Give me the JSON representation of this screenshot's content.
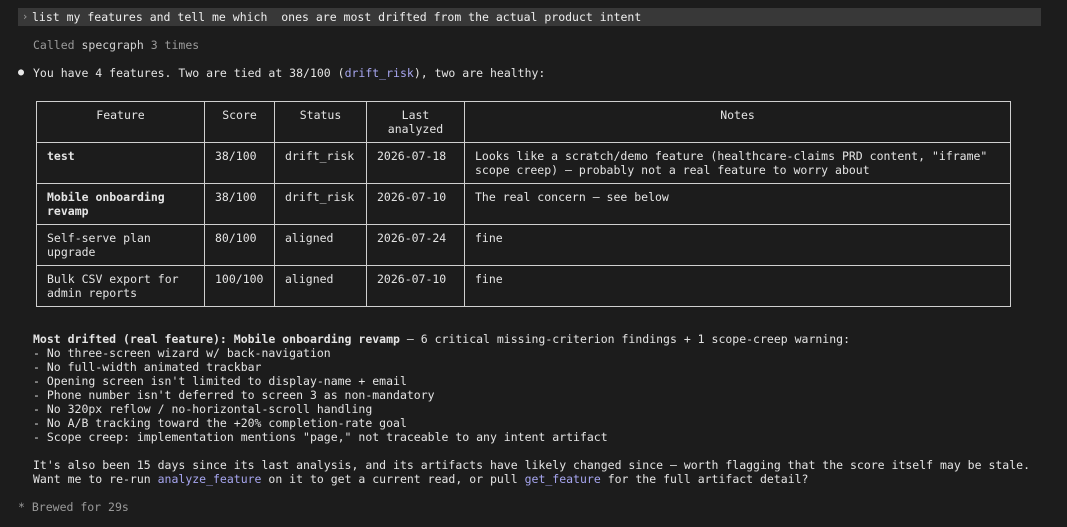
{
  "prompt": {
    "caret": "›",
    "text": "list my features and tell me which  ones are most drifted from the actual product intent"
  },
  "tool_call": {
    "prefix": "Called ",
    "tool": "specgraph",
    "suffix": " 3 times"
  },
  "answer": {
    "bullet": "●",
    "before": "You have 4 features. Two are tied at 38/100 (",
    "code": "drift_risk",
    "after": "), two are healthy:"
  },
  "table": {
    "headers": [
      "Feature",
      "Score",
      "Status",
      "Last analyzed",
      "Notes"
    ],
    "rows": [
      {
        "feature": "test",
        "bold": true,
        "score": "38/100",
        "status": "drift_risk",
        "analyzed": "2026-07-18",
        "notes": "Looks like a scratch/demo feature (healthcare-claims PRD content, \"iframe\" scope creep) — probably not a real feature to worry about"
      },
      {
        "feature": "Mobile onboarding revamp",
        "bold": true,
        "score": "38/100",
        "status": "drift_risk",
        "analyzed": "2026-07-10",
        "notes": "The real concern — see below"
      },
      {
        "feature": "Self-serve plan upgrade",
        "bold": false,
        "score": "80/100",
        "status": "aligned",
        "analyzed": "2026-07-24",
        "notes": "fine"
      },
      {
        "feature": "Bulk CSV export for admin reports",
        "bold": false,
        "score": "100/100",
        "status": "aligned",
        "analyzed": "2026-07-10",
        "notes": "fine"
      }
    ]
  },
  "report": {
    "heading_bold": "Most drifted (real feature): Mobile onboarding revamp",
    "heading_rest": " — 6 critical missing-criterion findings + 1 scope-creep warning:",
    "items": [
      "- No three-screen wizard w/ back-navigation",
      "- No full-width animated trackbar",
      "- Opening screen isn't limited to display-name + email",
      "- Phone number isn't deferred to screen 3 as non-mandatory",
      "- No 320px reflow / no-horizontal-scroll handling",
      "- No A/B tracking toward the +20% completion-rate goal",
      "- Scope creep: implementation mentions \"page,\" not traceable to any intent artifact"
    ]
  },
  "followup": {
    "line1": "It's also been 15 days since its last analysis, and its artifacts have likely changed since — worth flagging that the score itself may be stale.",
    "line2_a": "Want me to re-run ",
    "link1": "analyze_feature",
    "line2_b": " on it to get a current read, or pull ",
    "link2": "get_feature",
    "line2_c": " for the full artifact detail?"
  },
  "status": {
    "icon": "*",
    "text": "Brewed for 29s"
  }
}
